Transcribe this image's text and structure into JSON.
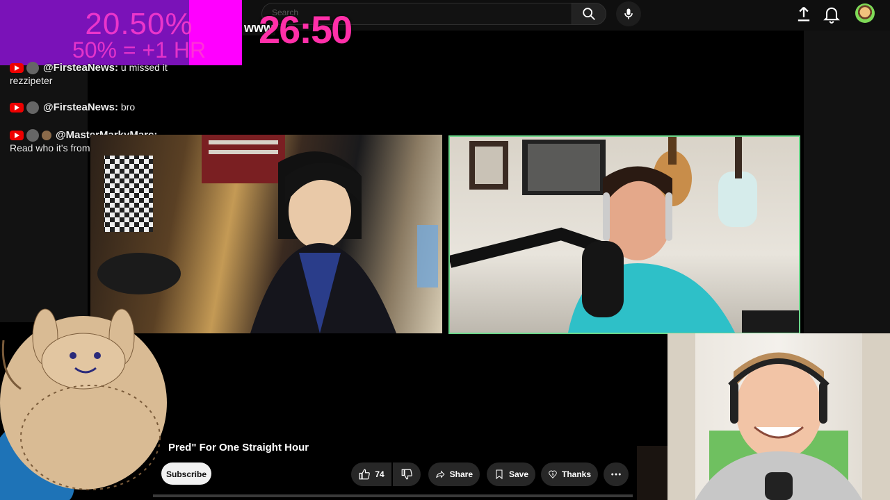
{
  "header": {
    "search_placeholder": "Search",
    "channel_peek": "www"
  },
  "overlay": {
    "percent": "20.50%",
    "rule": "50% = +1 HR",
    "timer": "26:50"
  },
  "chat": [
    {
      "user": "@FirsteaNews:",
      "message": "u missed it rezzipeter"
    },
    {
      "user": "@FirsteaNews:",
      "message": "bro"
    },
    {
      "user": "@MasterMarkyMarc:",
      "message": "Read who it's from"
    }
  ],
  "video": {
    "title": "Pred\" For One Straight Hour",
    "subscribe_label": "Subscribe",
    "like_count": "74",
    "share_label": "Share",
    "save_label": "Save",
    "thanks_label": "Thanks"
  },
  "colors": {
    "timer": "#ff2fa8",
    "percent_panel": "#7a12b8",
    "percent_accent": "#ff00ff",
    "active_speaker_border": "#6bd68a",
    "yt_red": "#ee0000"
  },
  "icons": {
    "search": "search-icon",
    "mic": "mic-icon",
    "upload": "upload-icon",
    "notifications": "bell-icon",
    "like": "thumbs-up-icon",
    "dislike": "thumbs-down-icon",
    "share": "share-arrow-icon",
    "save": "bookmark-icon",
    "thanks": "heart-dollar-icon",
    "more": "more-horizontal-icon"
  }
}
